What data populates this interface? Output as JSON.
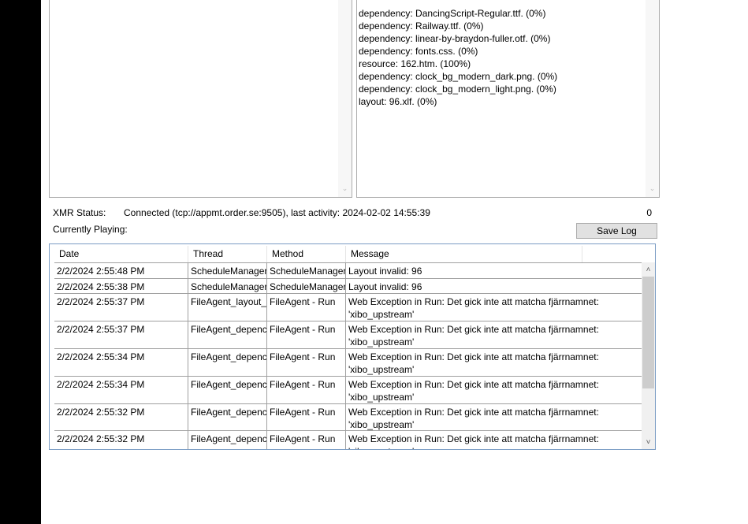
{
  "resources": [
    "dependency: DancingScript-Regular.ttf. (0%)",
    "dependency: Railway.ttf. (0%)",
    "dependency: linear-by-braydon-fuller.otf. (0%)",
    "dependency: fonts.css. (0%)",
    "resource: 162.htm. (100%)",
    "dependency: clock_bg_modern_dark.png. (0%)",
    "dependency: clock_bg_modern_light.png. (0%)",
    "layout: 96.xlf. (0%)"
  ],
  "status": {
    "xmr_label": "XMR Status:",
    "xmr_value": "Connected (tcp://appmt.order.se:9505), last activity: 2024-02-02 14:55:39",
    "count": "0",
    "playing_label": "Currently Playing:"
  },
  "save_log_label": "Save Log",
  "log": {
    "columns": [
      "Date",
      "Thread",
      "Method",
      "Message"
    ],
    "rows": [
      {
        "date": "2/2/2024 2:55:48 PM",
        "thread": "ScheduleManager",
        "method": "ScheduleManager",
        "message": "Layout invalid: 96"
      },
      {
        "date": "2/2/2024 2:55:38 PM",
        "thread": "ScheduleManager",
        "method": "ScheduleManager",
        "message": "Layout invalid: 96"
      },
      {
        "date": "2/2/2024 2:55:37 PM",
        "thread": "FileAgent_layout_",
        "method": "FileAgent - Run",
        "message": "Web Exception in Run: Det gick inte att matcha fjärrnamnet: 'xibo_upstream'"
      },
      {
        "date": "2/2/2024 2:55:37 PM",
        "thread": "FileAgent_depenc",
        "method": "FileAgent - Run",
        "message": "Web Exception in Run: Det gick inte att matcha fjärrnamnet: 'xibo_upstream'"
      },
      {
        "date": "2/2/2024 2:55:34 PM",
        "thread": "FileAgent_depenc",
        "method": "FileAgent - Run",
        "message": "Web Exception in Run: Det gick inte att matcha fjärrnamnet: 'xibo_upstream'"
      },
      {
        "date": "2/2/2024 2:55:34 PM",
        "thread": "FileAgent_depenc",
        "method": "FileAgent - Run",
        "message": "Web Exception in Run: Det gick inte att matcha fjärrnamnet: 'xibo_upstream'"
      },
      {
        "date": "2/2/2024 2:55:32 PM",
        "thread": "FileAgent_depenc",
        "method": "FileAgent - Run",
        "message": "Web Exception in Run: Det gick inte att matcha fjärrnamnet: 'xibo_upstream'"
      },
      {
        "date": "2/2/2024 2:55:32 PM",
        "thread": "FileAgent_depenc",
        "method": "FileAgent - Run",
        "message": "Web Exception in Run: Det gick inte att matcha fjärrnamnet: 'xibo_upstream'"
      }
    ]
  },
  "icons": {
    "scroll_up": "chevron-up-icon",
    "scroll_down": "chevron-down-icon"
  }
}
